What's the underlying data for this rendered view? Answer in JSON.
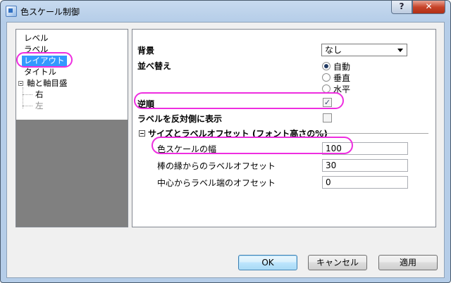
{
  "window": {
    "title": "色スケール制御",
    "help_label": "?",
    "close_label": "✕"
  },
  "tree": {
    "items": [
      {
        "label": "レベル",
        "selected": false,
        "disabled": false
      },
      {
        "label": "ラベル",
        "selected": false,
        "disabled": false
      },
      {
        "label": "レイアウト",
        "selected": true,
        "disabled": false
      },
      {
        "label": "タイトル",
        "selected": false,
        "disabled": false
      },
      {
        "label": "軸と軸目盛",
        "selected": false,
        "disabled": false
      },
      {
        "label": "右",
        "selected": false,
        "disabled": false
      },
      {
        "label": "左",
        "selected": false,
        "disabled": true
      }
    ]
  },
  "panel": {
    "background": {
      "label": "背景",
      "value": "なし"
    },
    "arrange": {
      "label": "並べ替え",
      "options": [
        "自動",
        "垂直",
        "水平"
      ],
      "selected_index": 0
    },
    "reverse": {
      "label": "逆順",
      "checked": true
    },
    "opposite_side": {
      "label": "ラベルを反対側に表示",
      "checked": false
    },
    "section": {
      "title": "サイズとラベルオフセット (フォント高さの%)",
      "width": {
        "label": "色スケールの幅",
        "value": "100"
      },
      "edge_offset": {
        "label": "棒の縁からのラベルオフセット",
        "value": "30"
      },
      "center_offset": {
        "label": "中心からラベル端のオフセット",
        "value": "0"
      }
    }
  },
  "buttons": {
    "ok": "OK",
    "cancel": "キャンセル",
    "apply": "適用"
  },
  "colors": {
    "highlight": "#ee2ee0",
    "selection": "#3399ff"
  }
}
